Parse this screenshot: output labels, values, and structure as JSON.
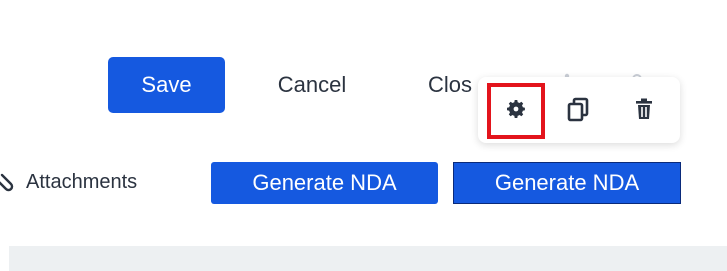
{
  "actions": {
    "save_label": "Save",
    "cancel_label": "Cancel",
    "close_label": "Clos"
  },
  "toolbar": {
    "icons": [
      "gear-icon",
      "copy-icon",
      "trash-icon"
    ],
    "highlight_color": "#e3141c"
  },
  "row2": {
    "attachments_label": "Attachments",
    "generate_nda_label_1": "Generate NDA",
    "generate_nda_label_2": "Generate NDA"
  },
  "colors": {
    "primary": "#1559e0",
    "text": "#2b3340",
    "band": "#edf0f2"
  }
}
